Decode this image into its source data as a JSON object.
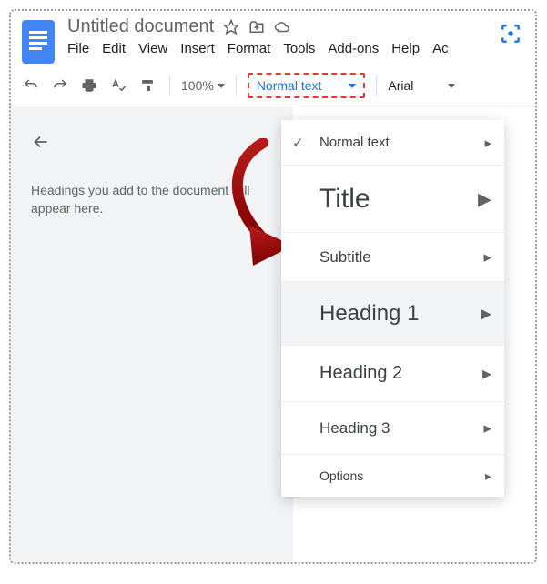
{
  "header": {
    "title": "Untitled document",
    "menus": [
      "File",
      "Edit",
      "View",
      "Insert",
      "Format",
      "Tools",
      "Add-ons",
      "Help",
      "Ac"
    ]
  },
  "toolbar": {
    "zoom": "100%",
    "style_selected": "Normal text",
    "font": "Arial"
  },
  "sidebar": {
    "outline_text": "Headings you add to the document will appear here."
  },
  "style_menu": {
    "items": [
      {
        "label": "Normal text",
        "checked": true,
        "class": "m-normal"
      },
      {
        "label": "Title",
        "checked": false,
        "class": "m-title"
      },
      {
        "label": "Subtitle",
        "checked": false,
        "class": "m-sub"
      },
      {
        "label": "Heading 1",
        "checked": false,
        "class": "m-h1",
        "hovered": true
      },
      {
        "label": "Heading 2",
        "checked": false,
        "class": "m-h2"
      },
      {
        "label": "Heading 3",
        "checked": false,
        "class": "m-h3"
      },
      {
        "label": "Options",
        "checked": false,
        "class": "m-opt"
      }
    ]
  }
}
